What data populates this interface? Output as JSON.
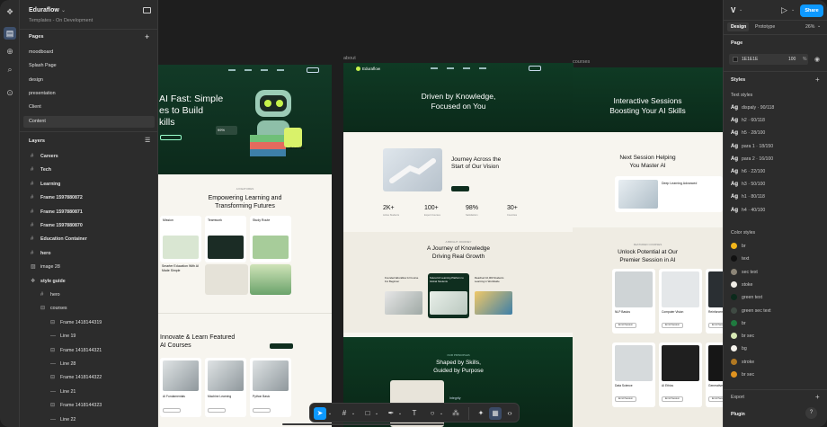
{
  "file": {
    "name": "Eduraflow",
    "subtitle": "Templates - On Development"
  },
  "pages": {
    "title": "Pages",
    "items": [
      "moodboard",
      "Splash Page",
      "design",
      "presentation",
      "Client",
      "Content"
    ],
    "selected": 5
  },
  "layers": {
    "title": "Layers",
    "items": [
      {
        "label": "Careers",
        "indent": 0,
        "icon": "#",
        "bold": true
      },
      {
        "label": "Tech",
        "indent": 0,
        "icon": "#",
        "bold": true
      },
      {
        "label": "Learning",
        "indent": 0,
        "icon": "#",
        "bold": true
      },
      {
        "label": "Frame 1597880872",
        "indent": 0,
        "icon": "#",
        "bold": true
      },
      {
        "label": "Frame 1597880871",
        "indent": 0,
        "icon": "#",
        "bold": true
      },
      {
        "label": "Frame 1597880870",
        "indent": 0,
        "icon": "#",
        "bold": true
      },
      {
        "label": "Education Container",
        "indent": 0,
        "icon": "#",
        "bold": true
      },
      {
        "label": "hero",
        "indent": 0,
        "icon": "#",
        "bold": true
      },
      {
        "label": "image 28",
        "indent": 0,
        "icon": "▨",
        "bold": false
      },
      {
        "label": "style guide",
        "indent": 0,
        "icon": "❖",
        "bold": true
      },
      {
        "label": "hero",
        "indent": 1,
        "icon": "#",
        "bold": false
      },
      {
        "label": "courses",
        "indent": 1,
        "icon": "⊟",
        "bold": false
      },
      {
        "label": "Frame 1418144319",
        "indent": 2,
        "icon": "⊟",
        "bold": false
      },
      {
        "label": "Line 19",
        "indent": 2,
        "icon": "—",
        "bold": false
      },
      {
        "label": "Frame 1418144321",
        "indent": 2,
        "icon": "⊟",
        "bold": false
      },
      {
        "label": "Line 28",
        "indent": 2,
        "icon": "—",
        "bold": false
      },
      {
        "label": "Frame 1418144322",
        "indent": 2,
        "icon": "⊟",
        "bold": false
      },
      {
        "label": "Line 21",
        "indent": 2,
        "icon": "—",
        "bold": false
      },
      {
        "label": "Frame 1418144323",
        "indent": 2,
        "icon": "⊟",
        "bold": false
      },
      {
        "label": "Line 22",
        "indent": 2,
        "icon": "—",
        "bold": false
      }
    ]
  },
  "canvas": {
    "labels": {
      "about": "about",
      "courses": "courses"
    },
    "home": {
      "hero_title": "AI Fast: Simple\nes to Build\nkills",
      "badge1": "99%",
      "badge2": "AI-Let Plan",
      "sec2_kicker": "AI FEATURES",
      "sec2_title": "Empowering Learning and\nTransforming Futures",
      "cards": [
        "Mission",
        "Teamwork",
        "Study Route"
      ],
      "card_sub": "Smarter Education With AI Made Simple",
      "sec3_title": "Innovate & Learn Featured\nAI Courses",
      "courses": [
        "AI Fundamentals",
        "Machine Learning",
        "Python Basic"
      ]
    },
    "about": {
      "brand": "Eduraflow",
      "hero_title": "Driven by Knowledge,\nFocused on You",
      "journey_title": "Journey Across the\nStart of Our Vision",
      "stats": [
        {
          "v": "2K+",
          "l": "Active Students"
        },
        {
          "v": "100+",
          "l": "Expert Courses"
        },
        {
          "v": "98%",
          "l": "Satisfaction"
        },
        {
          "v": "30+",
          "l": "Countries"
        }
      ],
      "growth_kicker": "A BRIGHT JOURNEY",
      "growth_title": "A Journey of Knowledge\nDriving Real Growth",
      "growth_cards": [
        "Founded Eduraflow AI Course For Beginner",
        "Solved AI Learning Platform to Global Students",
        "Reached 10,000 Students Learning in Worldwide"
      ],
      "shaped_kicker": "OUR PRINCIPLES",
      "shaped_title": "Shaped by Skills,\nGuided by Purpose",
      "integrity": "Integrity"
    },
    "courses": {
      "hero_title": "Interactive Sessions\nBoosting Your AI Skills",
      "next_title": "Next Session Helping\nYou Master AI",
      "next_card": "Deep Learning Advanced",
      "unlock_kicker": "FEATURED COURSES",
      "unlock_title": "Unlock Potential at Our\nPremier Session in AI",
      "grid": [
        "NLP Basics",
        "Computer Vision",
        "Reinforcement",
        "Data Science",
        "AI Ethics",
        "Generative AI"
      ],
      "btn": "Enroll Session"
    }
  },
  "design_panel": {
    "tabs": [
      "Design",
      "Prototype"
    ],
    "zoom": "26%",
    "share": "Share",
    "page_title": "Page",
    "page_color": "1E1E1E",
    "page_opacity": "100",
    "page_pct": "%",
    "styles_title": "Styles",
    "text_styles_title": "Text styles",
    "text_styles": [
      "dispaly · 90/118",
      "h2 · 60/118",
      "h5 · 28/100",
      "para 1 · 18/150",
      "para 2 · 16/100",
      "h6 · 22/100",
      "h3 · 50/100",
      "h1 · 80/118",
      "h4 · 40/100"
    ],
    "color_styles_title": "Color styles",
    "color_styles": [
      {
        "name": "br",
        "color": "#f2b51a"
      },
      {
        "name": "text",
        "color": "#111111"
      },
      {
        "name": "sec text",
        "color": "#8c8577"
      },
      {
        "name": "stoke",
        "color": "#f0ede6"
      },
      {
        "name": "green text",
        "color": "#0c2a1c"
      },
      {
        "name": "green sec text",
        "color": "#3f4a43"
      },
      {
        "name": "br",
        "color": "#1f7a3f"
      },
      {
        "name": "br sec",
        "color": "#d6e8b4"
      },
      {
        "name": "bg",
        "color": "#f5f2ec"
      },
      {
        "name": "stroke",
        "color": "#b07822"
      },
      {
        "name": "br sec",
        "color": "#e0931f"
      }
    ],
    "export": "Export",
    "plugin": "Plugin",
    "help": "?"
  },
  "colors": {
    "accent": "#0d99ff",
    "ui_bg": "#2c2c2c",
    "canvas": "#1e1e1e"
  }
}
